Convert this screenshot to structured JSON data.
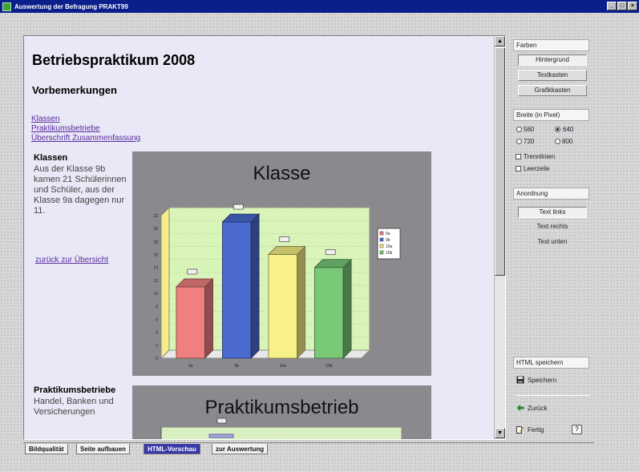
{
  "window": {
    "title": "Auswertung der Befragung   PRAKT99",
    "controls": [
      "_",
      "□",
      "×"
    ]
  },
  "document": {
    "title": "Betriebspraktikum 2008",
    "section_heading": "Vorbemerkungen",
    "toc_links": [
      "Klassen",
      "Praktikumsbetriebe",
      "Überschrift Zusammenfassung"
    ],
    "items": [
      {
        "heading": "Klassen",
        "text": "Aus der Klasse 9b kamen 21 Schülerinnen und Schüler, aus der Klasse 9a dagegen nur 11."
      },
      {
        "heading": "Praktikumsbetriebe",
        "text": "Handel, Banken und Versicherungen"
      }
    ],
    "back_link": "zurück zur Übersicht"
  },
  "chart_data": [
    {
      "type": "bar",
      "title": "Klasse",
      "categories": [
        "9a",
        "9b",
        "10a",
        "10b"
      ],
      "values": [
        11,
        21,
        16,
        14
      ],
      "colors": [
        "#f08080",
        "#4a6ad0",
        "#f8f088",
        "#78c878"
      ],
      "ylim": [
        0,
        22
      ],
      "yticks": [
        0,
        2,
        4,
        6,
        8,
        10,
        12,
        14,
        16,
        18,
        20,
        22
      ],
      "legend": [
        "9a",
        "9b",
        "10a",
        "10b"
      ],
      "legend_placement": "right",
      "grid": true
    },
    {
      "type": "bar",
      "title": "Praktikumsbetrieb"
    }
  ],
  "side_panel": {
    "farben": {
      "label": "Farben",
      "buttons": [
        "Hintergrund",
        "Textkasten",
        "Grafikkasten"
      ]
    },
    "breite": {
      "label": "Breite (in Pixel)",
      "options": [
        "560",
        "640",
        "720",
        "800"
      ],
      "selected": "640"
    },
    "checkboxes": [
      "Trennlinien",
      "Leerzeile"
    ],
    "anordnung": {
      "label": "Anordnung",
      "options": [
        "Text links",
        "Text rechts",
        "Text unten"
      ],
      "selected": "Text links"
    },
    "html_save": {
      "label": "HTML speichern",
      "save_button": "Speichern"
    },
    "back_button": "Zurück",
    "done_button": "Fertig",
    "help_button": "?"
  },
  "tabs": [
    {
      "label": "Bildqualität"
    },
    {
      "label": "Seite aufbauen"
    },
    {
      "label": "HTML-Vorschau"
    },
    {
      "label": "zur Auswertung"
    }
  ],
  "active_tab": "HTML-Vorschau"
}
